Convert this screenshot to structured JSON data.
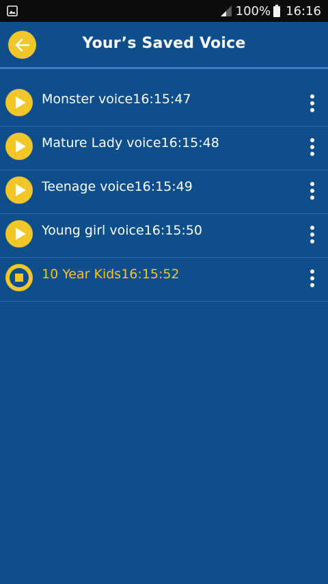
{
  "status_bar": {
    "battery": "100%",
    "time": "16:16"
  },
  "app_bar": {
    "title": "Your’s Saved Voice"
  },
  "recordings": [
    {
      "name": "Monster voice",
      "time": "16:15:47",
      "playing": false
    },
    {
      "name": "Mature Lady voice",
      "time": "16:15:48",
      "playing": false
    },
    {
      "name": "Teenage voice",
      "time": "16:15:49",
      "playing": false
    },
    {
      "name": "Young girl voice",
      "time": "16:15:50",
      "playing": false
    },
    {
      "name": "10 Year Kids",
      "time": "16:15:52",
      "playing": true
    }
  ],
  "icons": {
    "back": "arrow-left-icon",
    "play": "play-icon",
    "stop": "stop-icon",
    "more": "more-vertical-icon"
  },
  "colors": {
    "background": "#0e4f8b",
    "accent": "#f0c629",
    "status_bar": "#0c0c0c",
    "text": "#ffffff"
  }
}
